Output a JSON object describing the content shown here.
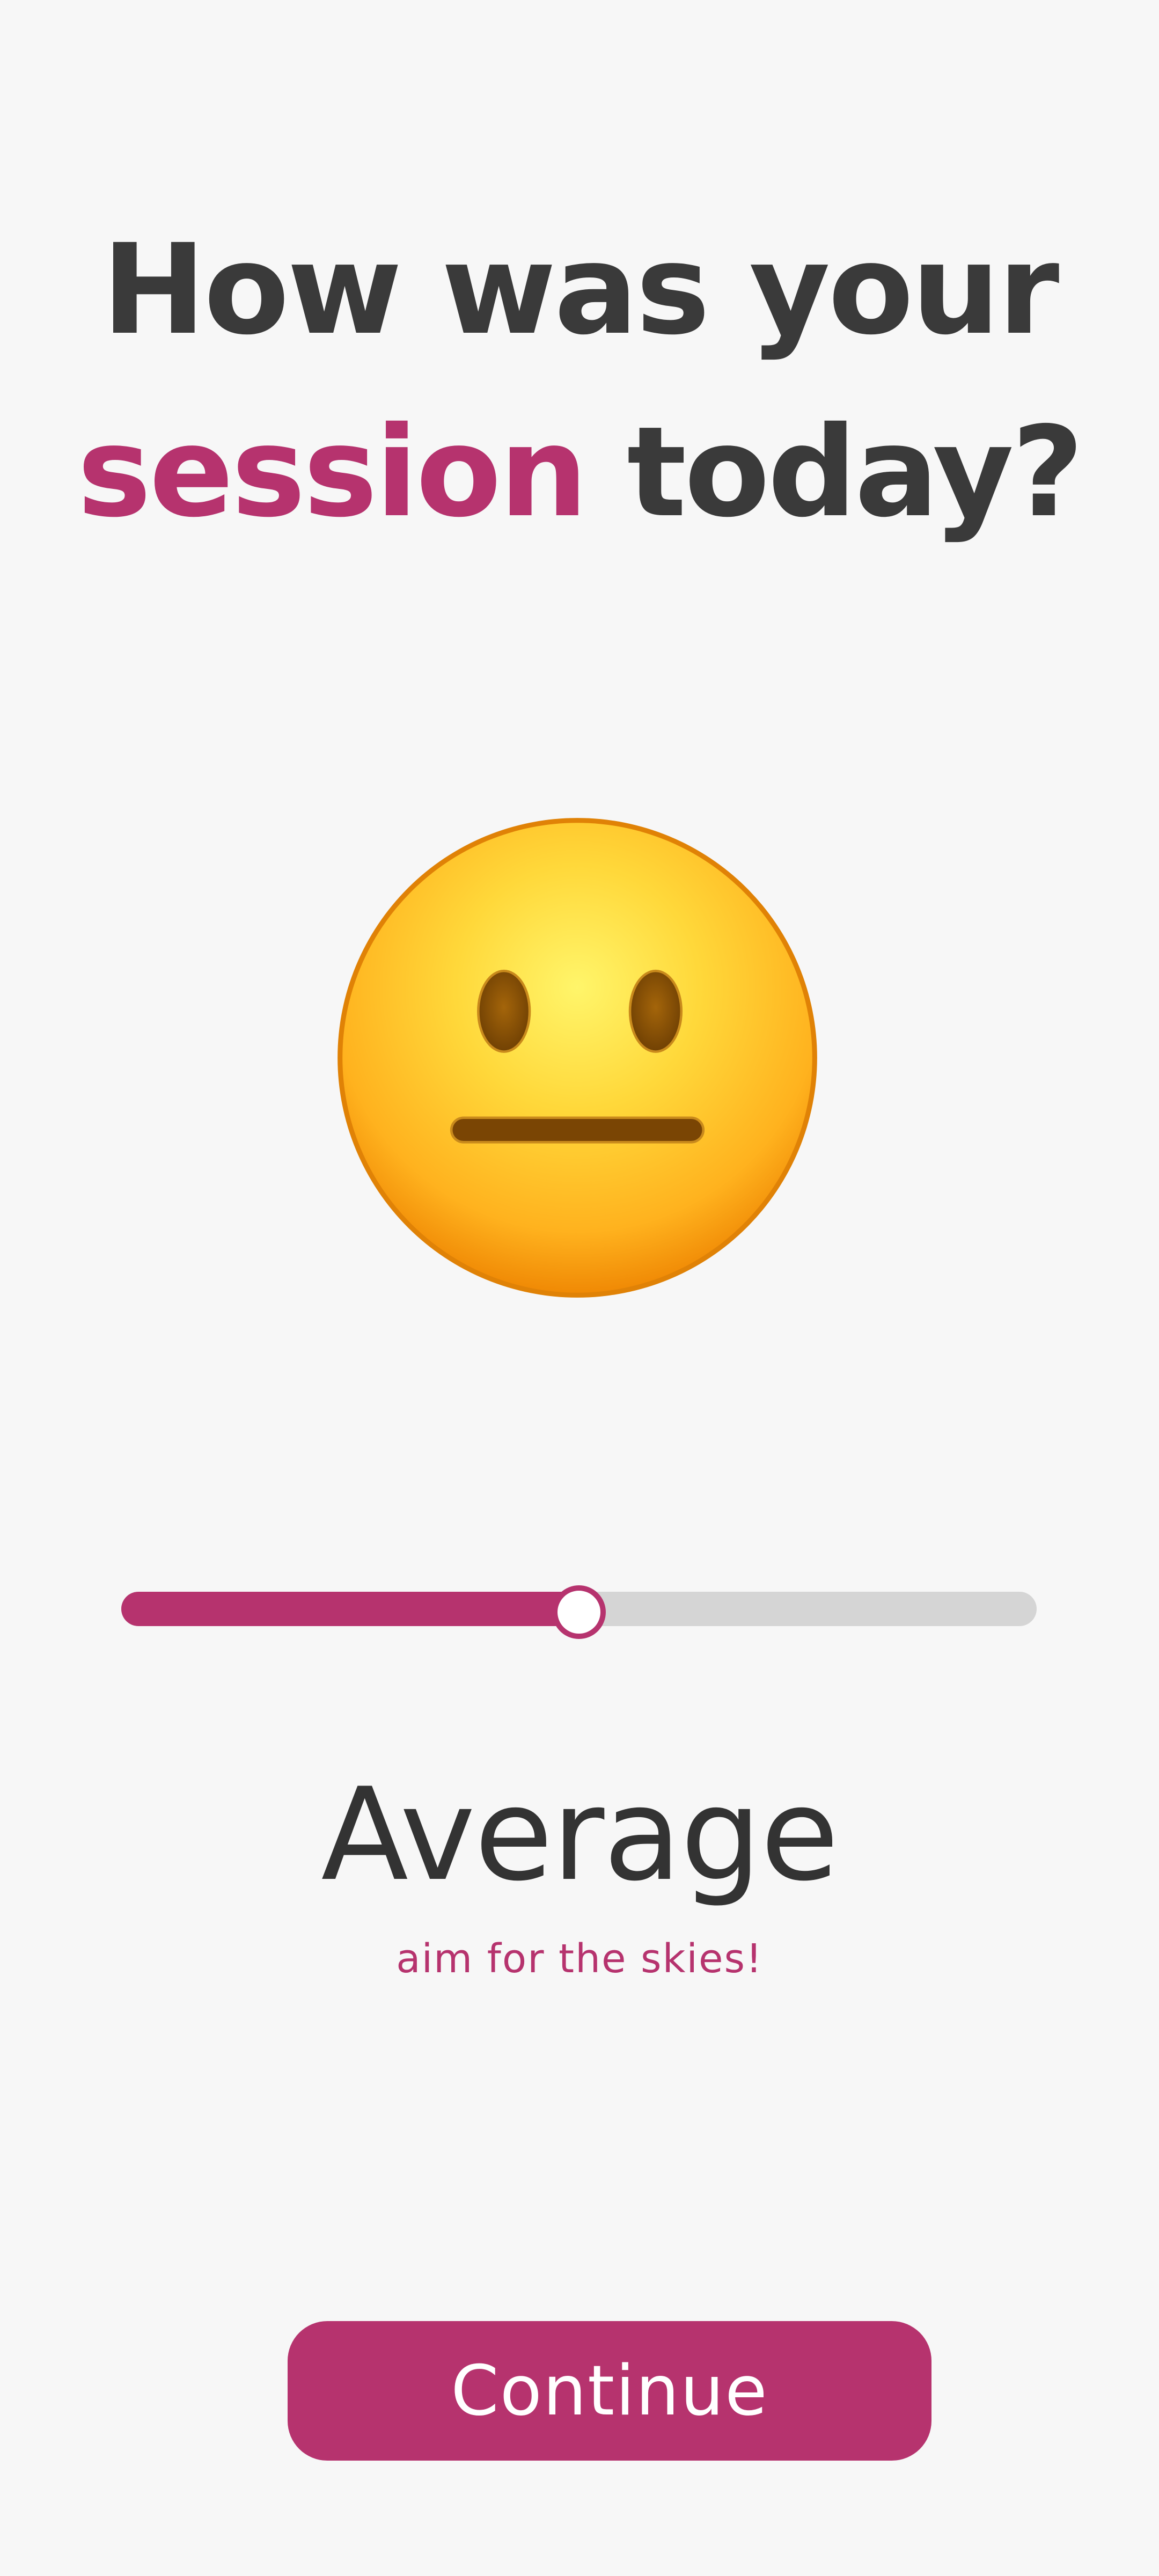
{
  "header": {
    "title_line1": "How was your",
    "title_accent": "session",
    "title_rest": " today?"
  },
  "rating": {
    "emoji": "neutral-face-icon",
    "slider_value": 0.5,
    "label": "Average",
    "subtitle": "aim for the skies!"
  },
  "actions": {
    "continue_label": "Continue"
  },
  "colors": {
    "accent": "#b6336e",
    "text": "#3a3a3a",
    "background": "#f7f7f7",
    "track": "#d5d5d5"
  }
}
